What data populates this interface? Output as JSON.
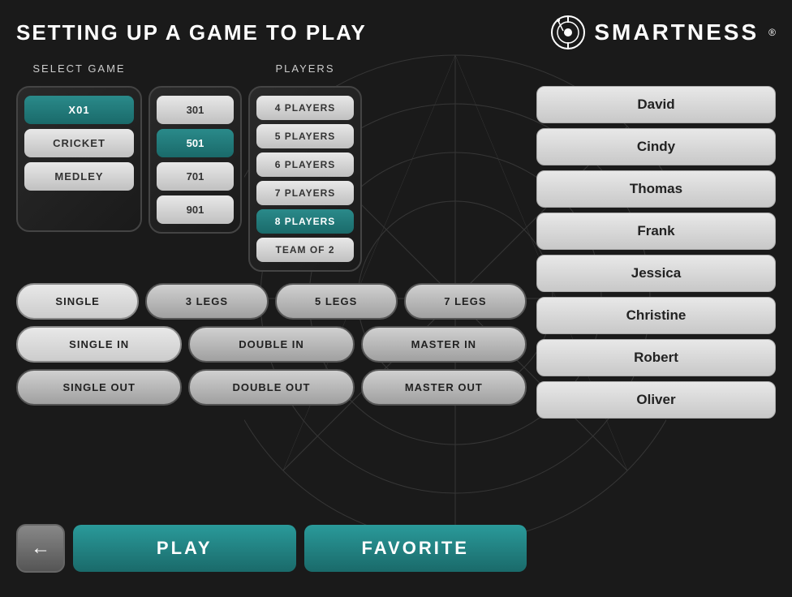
{
  "header": {
    "title": "SETTING UP A GAME TO PLAY",
    "logo_text": "SMARTNESS"
  },
  "select_game_label": "SELECT GAME",
  "players_label": "PLAYERS",
  "game_types": [
    {
      "label": "X01",
      "active": true
    },
    {
      "label": "CRICKET",
      "active": false
    },
    {
      "label": "MEDLEY",
      "active": false
    }
  ],
  "score_options": [
    {
      "label": "301",
      "active": false
    },
    {
      "label": "501",
      "active": true
    },
    {
      "label": "701",
      "active": false
    },
    {
      "label": "901",
      "active": false
    }
  ],
  "player_counts": [
    {
      "label": "4 PLAYERS",
      "active": false
    },
    {
      "label": "5 PLAYERS",
      "active": false
    },
    {
      "label": "6 PLAYERS",
      "active": false
    },
    {
      "label": "7 PLAYERS",
      "active": false
    },
    {
      "label": "8 PLAYERS",
      "active": true
    },
    {
      "label": "TEAM OF 2",
      "active": false
    }
  ],
  "leg_options": [
    {
      "label": "SINGLE",
      "active": true
    },
    {
      "label": "3 LEGS",
      "active": false
    },
    {
      "label": "5 LEGS",
      "active": false
    },
    {
      "label": "7 LEGS",
      "active": false
    }
  ],
  "in_options": [
    {
      "label": "SINGLE IN",
      "active": true
    },
    {
      "label": "DOUBLE IN",
      "active": false
    },
    {
      "label": "MASTER IN",
      "active": false
    }
  ],
  "out_options": [
    {
      "label": "SINGLE OUT",
      "active": false
    },
    {
      "label": "DOUBLE OUT",
      "active": false
    },
    {
      "label": "MASTER OUT",
      "active": false
    }
  ],
  "actions": {
    "back_icon": "←",
    "play": "PLAY",
    "favorite": "FAVORITE"
  },
  "players_list": [
    {
      "name": "David"
    },
    {
      "name": "Cindy"
    },
    {
      "name": "Thomas"
    },
    {
      "name": "Frank"
    },
    {
      "name": "Jessica"
    },
    {
      "name": "Christine"
    },
    {
      "name": "Robert"
    },
    {
      "name": "Oliver"
    }
  ]
}
